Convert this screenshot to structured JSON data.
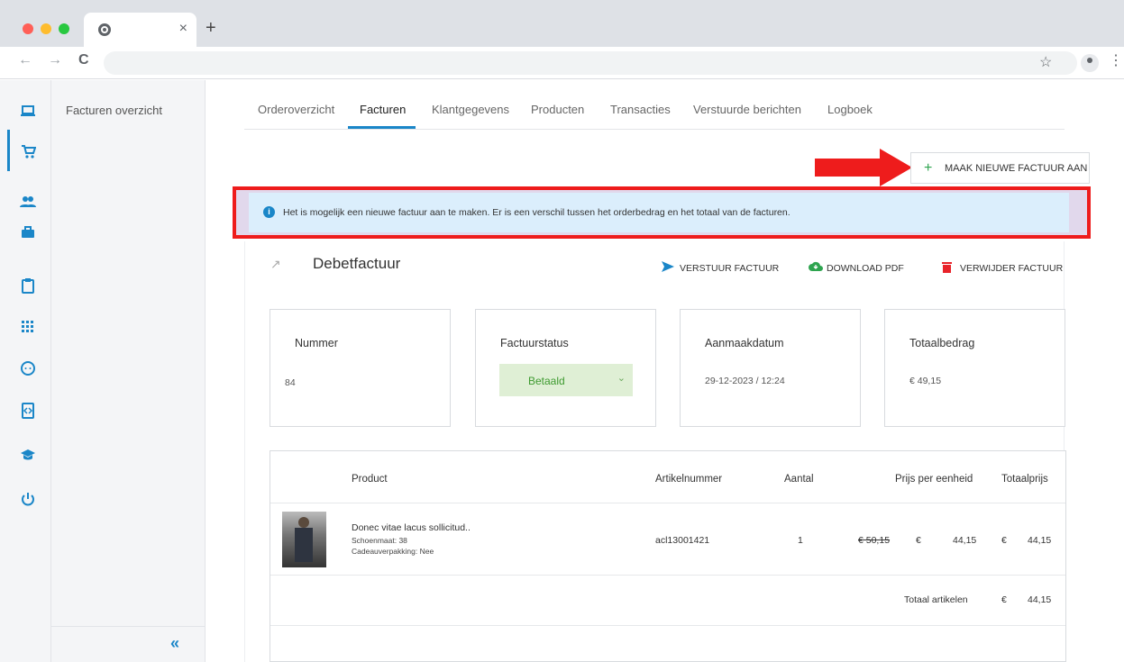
{
  "browser": {
    "tab_close": "×",
    "new_tab": "+",
    "back": "←",
    "forward": "→",
    "reload": "C",
    "star": "☆",
    "menu": "⋮"
  },
  "sidebar": {
    "icons": [
      "laptop-icon",
      "cart-icon",
      "users-icon",
      "briefcase-icon",
      "clipboard-icon",
      "grid-icon",
      "face-icon",
      "code-icon",
      "graduation-icon",
      "power-icon"
    ],
    "subnav_item": "Facturen overzicht",
    "collapse_label": "«"
  },
  "tabs": [
    "Orderoverzicht",
    "Facturen",
    "Klantgegevens",
    "Producten",
    "Transacties",
    "Verstuurde berichten",
    "Logboek"
  ],
  "new_invoice_button": {
    "icon": "+",
    "label": "MAAK NIEUWE FACTUUR AAN"
  },
  "info_banner": {
    "icon": "i",
    "text": "Het is mogelijk een nieuwe factuur aan te maken. Er is een verschil tussen het orderbedrag en het totaal van de facturen."
  },
  "invoice": {
    "trend_icon": "↗",
    "title": "Debetfactuur",
    "actions": {
      "send": "VERSTUUR FACTUUR",
      "download": "DOWNLOAD PDF",
      "delete": "VERWIJDER FACTUUR"
    },
    "boxes": {
      "number_label": "Nummer",
      "number_value": "84",
      "status_label": "Factuurstatus",
      "status_value": "Betaald",
      "date_label": "Aanmaakdatum",
      "date_value": "29-12-2023 / 12:24",
      "total_label": "Totaalbedrag",
      "total_value": "€ 49,15"
    },
    "table": {
      "headers": {
        "product": "Product",
        "sku": "Artikelnummer",
        "qty": "Aantal",
        "unit_price": "Prijs per eenheid",
        "total": "Totaalprijs"
      },
      "row": {
        "name": "Donec vitae lacus sollicitud..",
        "size": "Schoenmaat: 38",
        "gift": "Cadeauverpakking: Nee",
        "sku": "acl13001421",
        "qty": "1",
        "old_price": "€ 50,15",
        "currency": "€",
        "unit_price": "44,15",
        "total_currency": "€",
        "total": "44,15"
      },
      "footer": {
        "label": "Totaal artikelen",
        "currency": "€",
        "value": "44,15"
      }
    }
  },
  "colors": {
    "accent": "#1a86c8",
    "annotation": "#ee1c1c",
    "status_bg": "#dfefd5",
    "status_text": "#3d9a2f"
  }
}
